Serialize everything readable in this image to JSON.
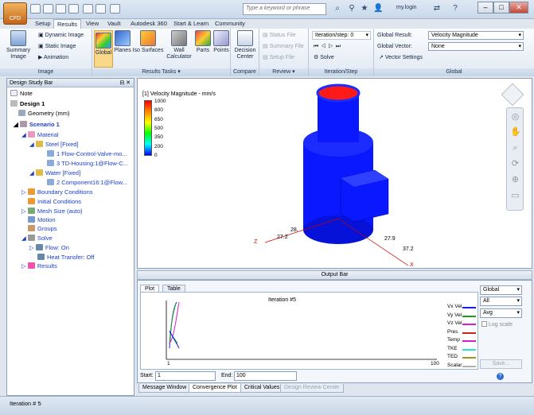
{
  "app": {
    "name": "CFD",
    "search_placeholder": "Type a keyword or phrase",
    "user": "my.login"
  },
  "tabs": [
    "Setup",
    "Results",
    "View",
    "Vault",
    "Autodesk 360",
    "Start & Learn",
    "Community"
  ],
  "ribbon": {
    "image": {
      "label": "Image",
      "summary": "Summary Image",
      "dynamic": "Dynamic Image",
      "static": "Static Image",
      "animation": "Animation"
    },
    "tasks": {
      "label": "Results Tasks",
      "global": "Global",
      "planes": "Planes",
      "iso": "Iso Surfaces",
      "wall": "Wall Calculator",
      "parts": "Parts",
      "points": "Points"
    },
    "compare": {
      "label": "Compare",
      "decision": "Decision Center"
    },
    "review": {
      "label": "Review",
      "status": "Status File",
      "summary": "Summary File",
      "setup": "Setup File"
    },
    "iteration": {
      "label": "Iteration/Step",
      "select": "Iteration/step: 0",
      "solve": "Solve"
    },
    "global": {
      "label": "Global",
      "result_label": "Global Result:",
      "result_value": "Velocity Magnitude",
      "vector_label": "Global Vector:",
      "vector_value": "None",
      "vector_settings": "Vector Settings"
    }
  },
  "design_bar": {
    "title": "Design Study Bar",
    "note": "Note",
    "design": "Design 1",
    "geometry": "Geometry (mm)",
    "scenario": "Scenario 1",
    "material": "Material",
    "steel": "Steel [Fixed]",
    "steel_item1": "1 Flow-Control-Valve-mo...",
    "steel_item2": "3 TD-Housing:1@Flow-C...",
    "water": "Water [Fixed]",
    "water_item1": "2 Component16:1@Flow...",
    "boundary": "Boundary Conditions",
    "initial": "Initial Conditions",
    "mesh": "Mesh Size (auto)",
    "motion": "Motion",
    "groups": "Groups",
    "solve": "Solve",
    "flow": "Flow: On",
    "heat": "Heat Transfer: Off",
    "results": "Results"
  },
  "viewport": {
    "legend_title": "[1] Velocity Magnitude - mm/s",
    "legend_ticks": [
      "1000",
      "800",
      "650",
      "500",
      "350",
      "200",
      "0"
    ],
    "axis_labels": [
      "27.2",
      "28.",
      "27.9",
      "37.2"
    ],
    "axis_x": "X",
    "axis_z": "Z"
  },
  "output": {
    "bar_label": "Output Bar",
    "tabs": [
      "Plot",
      "Table"
    ],
    "plot_title": "Iteration #5",
    "x_min": "1",
    "x_max": "100",
    "legend": [
      {
        "name": "Vx Vel",
        "color": "#1a1aff"
      },
      {
        "name": "Vy Vel",
        "color": "#18a018"
      },
      {
        "name": "Vz Vel",
        "color": "#d020d0"
      },
      {
        "name": "Pres",
        "color": "#d02020"
      },
      {
        "name": "Temp",
        "color": "#d020d0"
      },
      {
        "name": "TKE",
        "color": "#20e0e0"
      },
      {
        "name": "TED",
        "color": "#9a9a20"
      },
      {
        "name": "Scalar",
        "color": "#b0b0b0"
      }
    ],
    "dropdowns": [
      "Global",
      "All",
      "Avg"
    ],
    "log_scale": "Log scale",
    "start_label": "Start:",
    "start_value": "1",
    "end_label": "End:",
    "end_value": "100",
    "save": "Save..."
  },
  "bottom_tabs": [
    "Message Window",
    "Convergence Plot",
    "Critical Values",
    "Design Review Center"
  ],
  "status": "Iteration # 5"
}
